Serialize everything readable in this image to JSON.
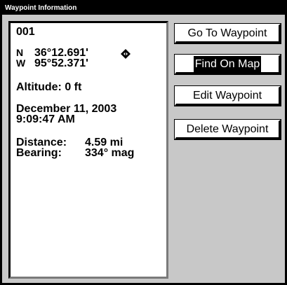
{
  "window": {
    "title": "Waypoint Information"
  },
  "waypoint": {
    "name": "001",
    "lat_dir": "N",
    "lat_value": "36°12.691'",
    "lon_dir": "W",
    "lon_value": "95°52.371'",
    "altitude": "Altitude: 0 ft",
    "date": "December 11, 2003",
    "time": "9:09:47 AM",
    "distance_label": "Distance:",
    "distance_value": "4.59 mi",
    "bearing_label": "Bearing:",
    "bearing_value": "334° mag",
    "icon": "waypoint-diamond-icon"
  },
  "buttons": {
    "goto": "Go To Waypoint",
    "find": "Find On Map",
    "edit": "Edit Waypoint",
    "delete": "Delete Waypoint",
    "selected": "find"
  },
  "colors": {
    "background": "#c8c8c8",
    "panel": "#ffffff",
    "title_bar": "#000000",
    "highlight": "#000000"
  }
}
